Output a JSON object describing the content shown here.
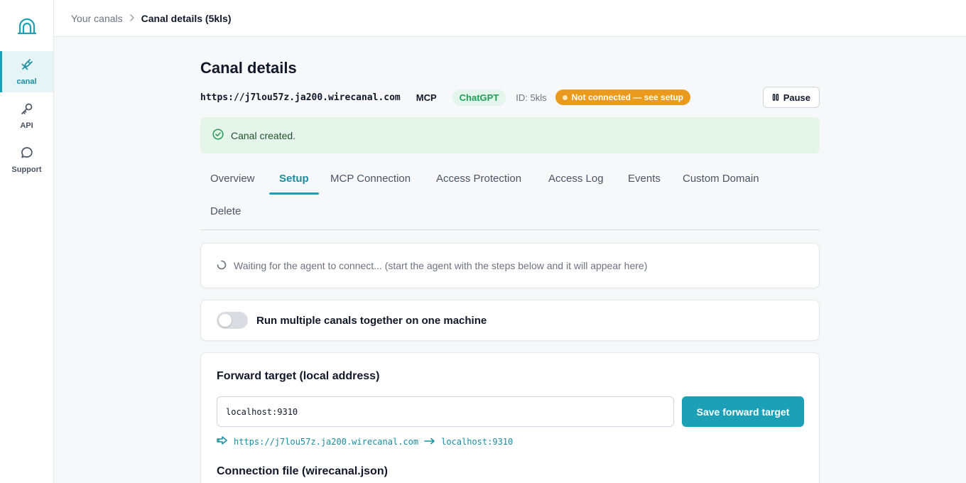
{
  "sidebar": {
    "logo_icon": "tunnel-arch-icon",
    "items": [
      {
        "label": "canal",
        "icon": "plug-icon",
        "active": true
      },
      {
        "label": "API",
        "icon": "key-icon",
        "active": false
      },
      {
        "label": "Support",
        "icon": "chat-bubble-icon",
        "active": false
      }
    ]
  },
  "breadcrumb": {
    "parent": "Your canals",
    "current": "Canal details (5kls)"
  },
  "page": {
    "title": "Canal details",
    "url": "https://j7lou57z.ja200.wirecanal.com",
    "protocol": "MCP",
    "client": "ChatGPT",
    "id_text": "ID: 5kls",
    "status": "Not connected — see setup",
    "pause_label": "Pause"
  },
  "alert": {
    "message": "Canal created."
  },
  "tabs": [
    {
      "label": "Overview"
    },
    {
      "label": "Setup",
      "active": true
    },
    {
      "label": "MCP Connection"
    },
    {
      "label": "Access Protection"
    },
    {
      "label": "Access Log"
    },
    {
      "label": "Events"
    },
    {
      "label": "Custom Domain"
    },
    {
      "label": "Delete"
    }
  ],
  "waiting": {
    "message": "Waiting for the agent to connect... (start the agent with the steps below and it will appear here)"
  },
  "multi": {
    "label": "Run multiple canals together on one machine",
    "enabled": false
  },
  "forward": {
    "title": "Forward target (local address)",
    "value": "localhost:9310",
    "save_label": "Save forward target",
    "route_from": "https://j7lou57z.ja200.wirecanal.com",
    "route_to": "localhost:9310"
  },
  "connection_file": {
    "title": "Connection file (wirecanal.json)"
  },
  "colors": {
    "accent": "#1ba0b6",
    "success_bg": "#e6f5ea",
    "warning": "#ea9a1d",
    "chatgpt_bg": "#e3f5ec",
    "chatgpt_text": "#1f9d5a"
  }
}
